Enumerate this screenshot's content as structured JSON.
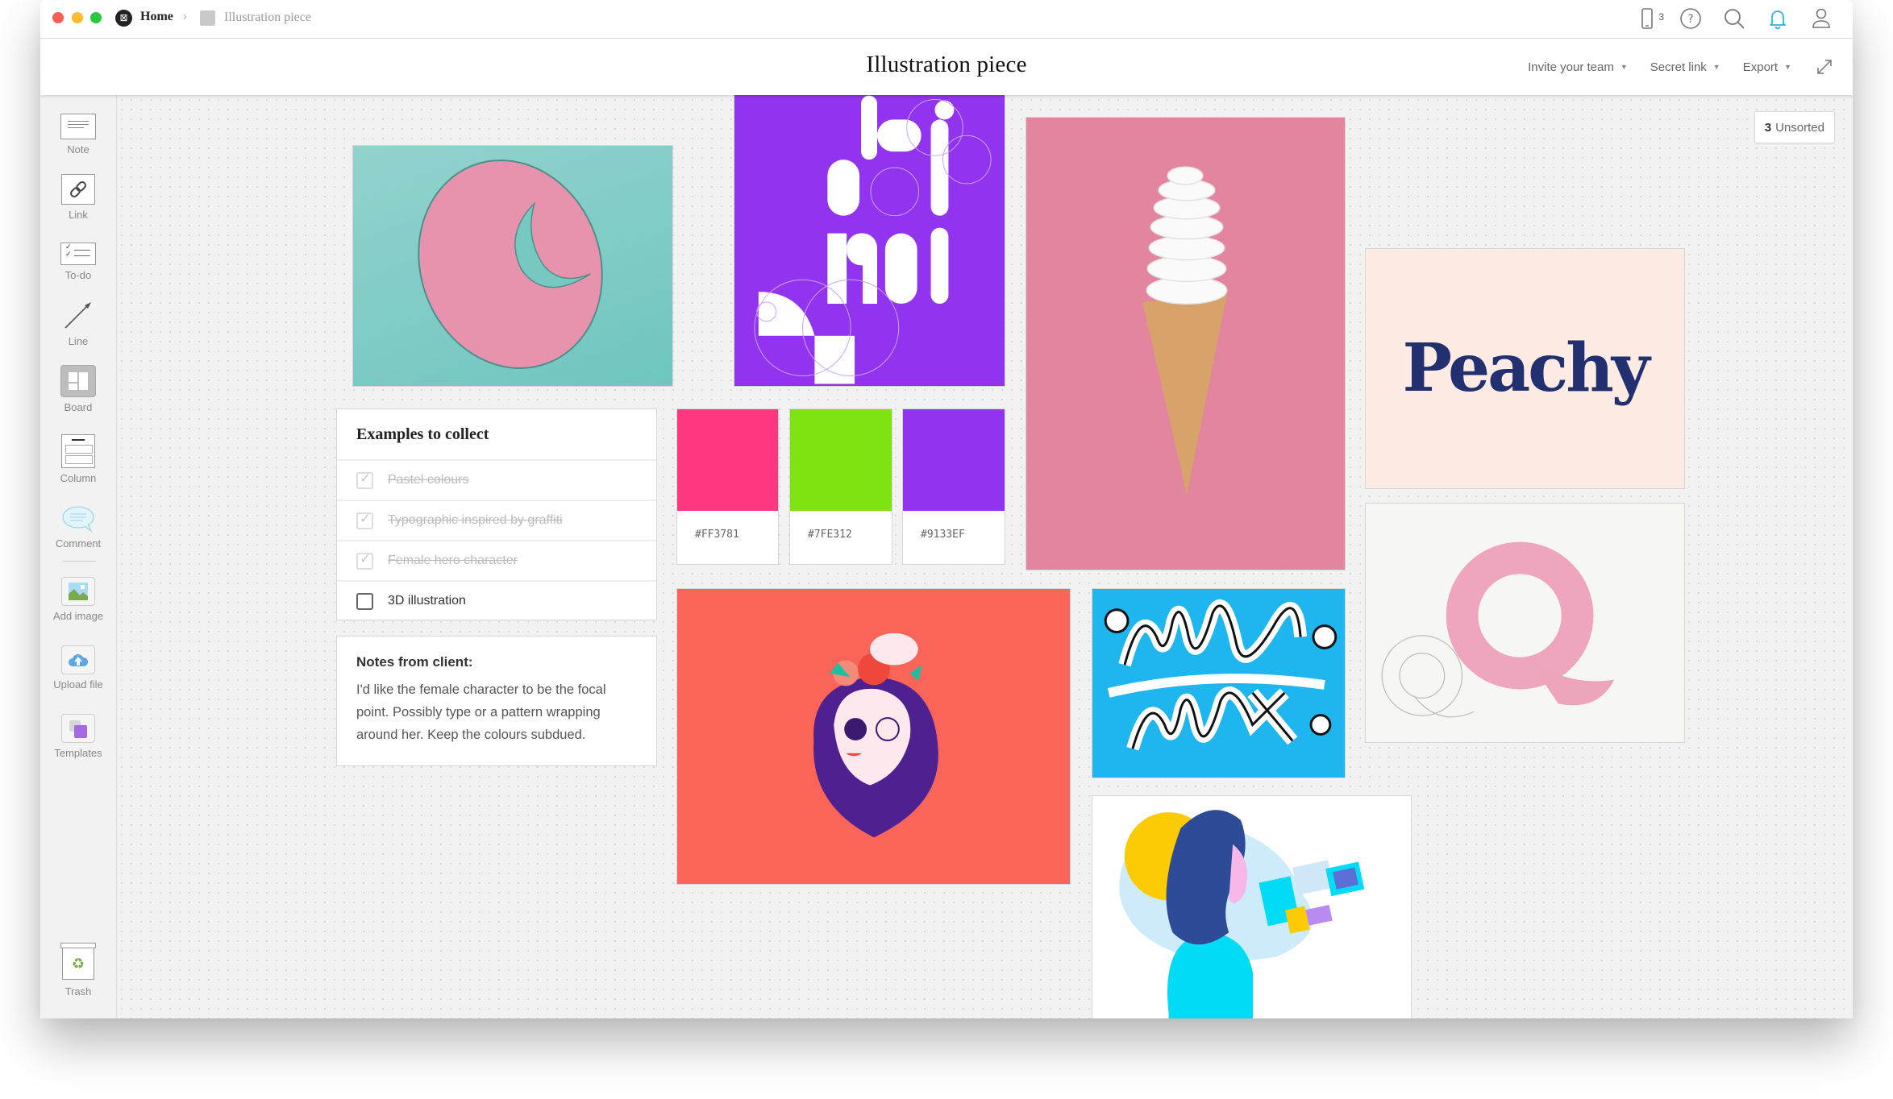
{
  "window": {
    "traffic_lights": [
      "close",
      "minimize",
      "zoom"
    ],
    "breadcrumb": {
      "home": "Home",
      "separator": "›",
      "current": "Illustration piece"
    },
    "top_icons": {
      "mobile_count": "3"
    }
  },
  "header": {
    "title": "Illustration piece",
    "actions": [
      {
        "label": "Invite your team",
        "caret": "▼"
      },
      {
        "label": "Secret link",
        "caret": "▼"
      },
      {
        "label": "Export",
        "caret": "▼"
      }
    ]
  },
  "sidebar": {
    "tools": [
      {
        "label": "Note",
        "icon": "note-icon"
      },
      {
        "label": "Link",
        "icon": "link-icon"
      },
      {
        "label": "To-do",
        "icon": "todo-icon"
      },
      {
        "label": "Line",
        "icon": "line-arrow-icon"
      },
      {
        "label": "Board",
        "icon": "board-icon"
      },
      {
        "label": "Column",
        "icon": "column-icon"
      },
      {
        "label": "Comment",
        "icon": "comment-icon"
      },
      {
        "label": "Add image",
        "icon": "image-icon"
      },
      {
        "label": "Upload file",
        "icon": "upload-cloud-icon"
      },
      {
        "label": "Templates",
        "icon": "templates-icon"
      }
    ],
    "trash": {
      "label": "Trash",
      "icon": "trash-icon"
    }
  },
  "canvas": {
    "unsorted": {
      "count": "3",
      "label": "Unsorted"
    },
    "todo": {
      "title": "Examples to collect",
      "items": [
        {
          "text": "Pastel colours",
          "done": true
        },
        {
          "text": "Typographic inspired by graffiti",
          "done": true
        },
        {
          "text": "Female hero character",
          "done": true
        },
        {
          "text": "3D illustration",
          "done": false
        }
      ]
    },
    "note": {
      "heading": "Notes from client:",
      "body": "I'd like the female character to be the focal point. Possibly type or a pattern wrapping around her. Keep the colours subdued."
    },
    "swatches": [
      {
        "hex": "#FF3781"
      },
      {
        "hex": "#7FE312"
      },
      {
        "hex": "#9133EF"
      }
    ],
    "images": {
      "peachy_text": "Peachy",
      "teal_swirl": {
        "bg": "#7fcfc8",
        "fg": "#e993ad"
      },
      "purple_type": {
        "bg": "#9133ef"
      },
      "ice_cream": {
        "bg": "#e4859f"
      },
      "peachy": {
        "bg": "#fdebe4",
        "fg": "#22306f"
      },
      "woman_red": {
        "bg": "#fa6459"
      },
      "mix_blue": {
        "bg": "#1fb6ef"
      },
      "q_pink": {
        "bg": "#f6f6f2"
      },
      "woman_blue": {
        "bg": "#ffffff"
      }
    }
  }
}
